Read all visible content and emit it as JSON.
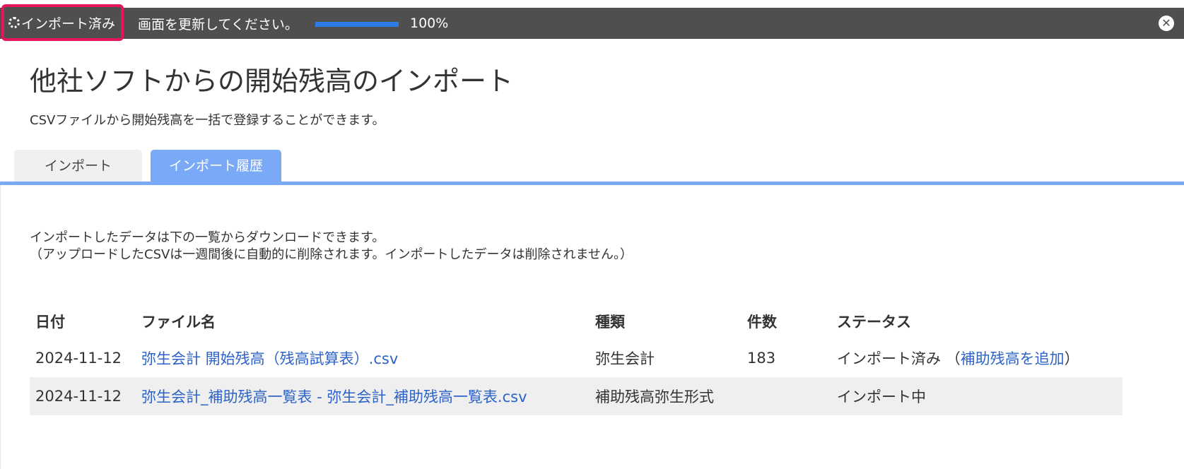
{
  "topbar": {
    "status_label": "インポート済み",
    "message": "画面を更新してください。",
    "progress": 1.0,
    "progress_label": "100%",
    "close_glyph": "✕",
    "close_icon": "close-circle-icon"
  },
  "page": {
    "title": "他社ソフトからの開始残高のインポート",
    "description": "CSVファイルから開始残高を一括で登録することができます。"
  },
  "tabs": [
    {
      "label": "インポート",
      "active": false
    },
    {
      "label": "インポート履歴",
      "active": true
    }
  ],
  "info": {
    "line1": "インポートしたデータは下の一覧からダウンロードできます。",
    "line2": "（アップロードしたCSVは一週間後に自動的に削除されます。インポートしたデータは削除されません。）"
  },
  "table": {
    "headers": [
      "日付",
      "ファイル名",
      "種類",
      "件数",
      "ステータス"
    ],
    "rows": [
      {
        "date": "2024-11-12",
        "file": "弥生会計 開始残高（残高試算表）.csv",
        "type": "弥生会計",
        "count": "183",
        "status": "インポート済み",
        "status_open": "（",
        "status_link": "補助残高を追加",
        "status_close": "）"
      },
      {
        "date": "2024-11-12",
        "file": "弥生会計_補助残高一覧表 - 弥生会計_補助残高一覧表.csv",
        "type": "補助残高弥生形式",
        "count": "",
        "status": "インポート中",
        "status_open": "",
        "status_link": "",
        "status_close": ""
      }
    ]
  },
  "colors": {
    "topbar_bg": "#4f4f4f",
    "highlight_border": "#e6165a",
    "progress_fill": "#2d7be6",
    "tab_active": "#7aaaf7",
    "link": "#2d63c8"
  }
}
